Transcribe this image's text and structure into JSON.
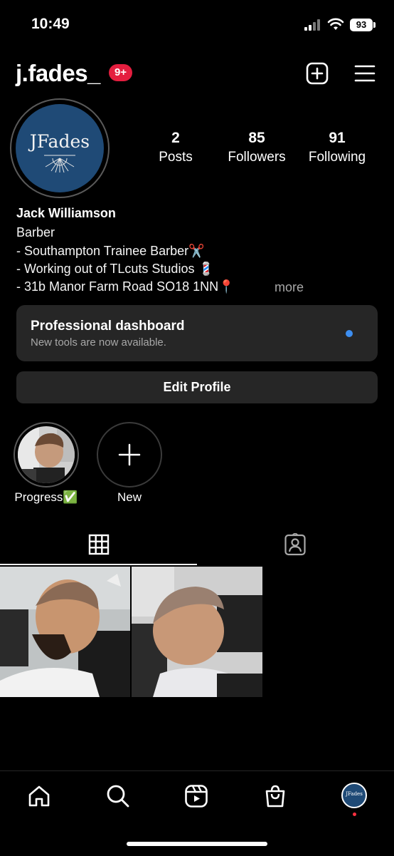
{
  "status_bar": {
    "time": "10:49",
    "battery": "93"
  },
  "header": {
    "username": "j.fades_",
    "notification_badge": "9+"
  },
  "profile": {
    "avatar_text": "JFades",
    "stats": [
      {
        "value": "2",
        "label": "Posts"
      },
      {
        "value": "85",
        "label": "Followers"
      },
      {
        "value": "91",
        "label": "Following"
      }
    ],
    "name": "Jack Williamson",
    "category": "Barber",
    "bio": [
      "- Southampton Trainee Barber✂️",
      "- Working out of TLcuts Studios 💈",
      "- 31b Manor Farm Road SO18 1NN📍"
    ],
    "more": "more"
  },
  "dashboard": {
    "title": "Professional dashboard",
    "subtitle": "New tools are now available."
  },
  "edit_profile": "Edit Profile",
  "highlights": [
    {
      "label": "Progress✅"
    },
    {
      "label": "New"
    }
  ],
  "colors": {
    "background": "#000000",
    "card": "#262626",
    "badge": "#e41e3f",
    "dot": "#3d8ef0",
    "avatar": "#1f4a76"
  }
}
